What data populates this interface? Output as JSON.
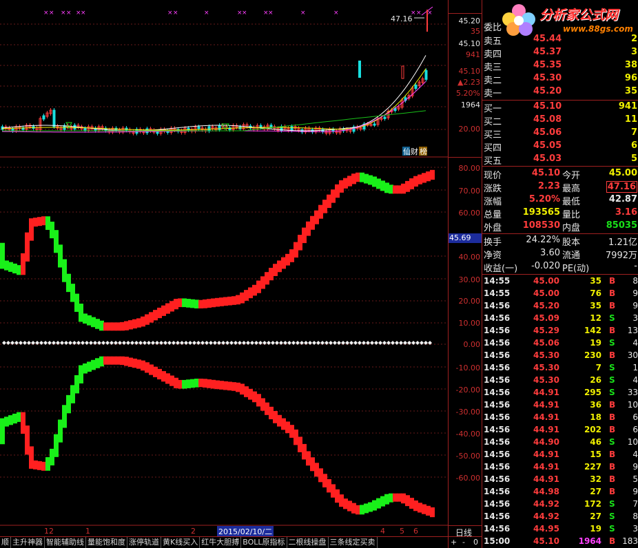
{
  "logo": {
    "site_name": "分析家公式网",
    "url_text": "www.88gs.com"
  },
  "price_chart": {
    "high_label": "47.16",
    "axis": [
      "45.20",
      "35",
      "45.10",
      "941",
      "45.10",
      "▲2.23",
      "5.20%",
      "1964",
      "20.00"
    ],
    "mark_1": "仙",
    "mark_2": "财",
    "mark_3": "榜"
  },
  "osc_axis": [
    "80.00",
    "70.00",
    "60.00",
    "45.69",
    "40.00",
    "30.00",
    "20.00",
    "10.00",
    "0.00",
    "-10.00",
    "-20.00",
    "-30.00",
    "-40.00",
    "-50.00",
    "-60.00"
  ],
  "date_axis": {
    "labels": [
      "12",
      "1",
      "2",
      "2015/02/10/二",
      "4",
      "5",
      "6"
    ]
  },
  "tabs": [
    "顺",
    "主升神器",
    "智能辅助线",
    "量能饱和度",
    "涨停轨道",
    "黄K线买入",
    "红牛大胆搏",
    "BOLL原指标",
    "二根线操盘",
    "三条线定买卖"
  ],
  "period": "日线",
  "nav_buttons": [
    "+",
    "-",
    "0"
  ],
  "orderbook": {
    "ratio_label": "委比",
    "sell": [
      {
        "label": "卖五",
        "price": "45.44",
        "vol": "2"
      },
      {
        "label": "卖四",
        "price": "45.37",
        "vol": "3"
      },
      {
        "label": "卖三",
        "price": "45.35",
        "vol": "38"
      },
      {
        "label": "卖二",
        "price": "45.30",
        "vol": "96"
      },
      {
        "label": "卖一",
        "price": "45.20",
        "vol": "35"
      }
    ],
    "buy": [
      {
        "label": "买一",
        "price": "45.10",
        "vol": "941"
      },
      {
        "label": "买二",
        "price": "45.08",
        "vol": "11"
      },
      {
        "label": "买三",
        "price": "45.06",
        "vol": "7"
      },
      {
        "label": "买四",
        "price": "45.05",
        "vol": "6"
      },
      {
        "label": "买五",
        "price": "45.03",
        "vol": "5"
      }
    ]
  },
  "stats": [
    {
      "l1": "现价",
      "v1": "45.10",
      "l2": "今开",
      "v2": "45.00"
    },
    {
      "l1": "涨跌",
      "v1": "2.23",
      "l2": "最高",
      "v2": "47.16"
    },
    {
      "l1": "涨幅",
      "v1": "5.20%",
      "l2": "最低",
      "v2": "42.87"
    },
    {
      "l1": "总量",
      "v1": "193565",
      "l2": "量比",
      "v2": "3.16"
    },
    {
      "l1": "外盘",
      "v1": "108530",
      "l2": "内盘",
      "v2": "85035"
    }
  ],
  "fund": [
    {
      "l1": "换手",
      "v1": "24.22%",
      "l2": "股本",
      "v2": "1.21亿"
    },
    {
      "l1": "净资",
      "v1": "3.60",
      "l2": "流通",
      "v2": "7992万"
    },
    {
      "l1": "收益(一)",
      "v1": "-0.020",
      "l2": "PE(动)",
      "v2": "-"
    }
  ],
  "ticks": [
    {
      "t": "14:55",
      "p": "45.00",
      "v": "35",
      "bs": "B",
      "n": "8"
    },
    {
      "t": "14:55",
      "p": "45.00",
      "v": "76",
      "bs": "B",
      "n": "9"
    },
    {
      "t": "14:56",
      "p": "45.20",
      "v": "35",
      "bs": "B",
      "n": "9"
    },
    {
      "t": "14:56",
      "p": "45.09",
      "v": "12",
      "bs": "S",
      "n": "3"
    },
    {
      "t": "14:56",
      "p": "45.29",
      "v": "142",
      "bs": "B",
      "n": "13"
    },
    {
      "t": "14:56",
      "p": "45.06",
      "v": "19",
      "bs": "S",
      "n": "4"
    },
    {
      "t": "14:56",
      "p": "45.30",
      "v": "230",
      "bs": "B",
      "n": "30"
    },
    {
      "t": "14:56",
      "p": "45.30",
      "v": "7",
      "bs": "S",
      "n": "1"
    },
    {
      "t": "14:56",
      "p": "45.30",
      "v": "26",
      "bs": "S",
      "n": "4"
    },
    {
      "t": "14:56",
      "p": "44.91",
      "v": "295",
      "bs": "S",
      "n": "33"
    },
    {
      "t": "14:56",
      "p": "44.91",
      "v": "36",
      "bs": "B",
      "n": "10"
    },
    {
      "t": "14:56",
      "p": "44.91",
      "v": "18",
      "bs": "B",
      "n": "6"
    },
    {
      "t": "14:56",
      "p": "44.91",
      "v": "202",
      "bs": "B",
      "n": "6"
    },
    {
      "t": "14:56",
      "p": "44.90",
      "v": "46",
      "bs": "S",
      "n": "10"
    },
    {
      "t": "14:56",
      "p": "44.91",
      "v": "15",
      "bs": "B",
      "n": "4"
    },
    {
      "t": "14:56",
      "p": "44.91",
      "v": "227",
      "bs": "B",
      "n": "9"
    },
    {
      "t": "14:56",
      "p": "44.91",
      "v": "32",
      "bs": "B",
      "n": "5"
    },
    {
      "t": "14:56",
      "p": "44.98",
      "v": "27",
      "bs": "B",
      "n": "9"
    },
    {
      "t": "14:56",
      "p": "44.92",
      "v": "172",
      "bs": "S",
      "n": "7"
    },
    {
      "t": "14:56",
      "p": "44.92",
      "v": "27",
      "bs": "S",
      "n": "8"
    },
    {
      "t": "14:56",
      "p": "44.95",
      "v": "19",
      "bs": "S",
      "n": "3"
    },
    {
      "t": "15:00",
      "p": "45.10",
      "v": "1964",
      "bs": "B",
      "n": "183"
    }
  ],
  "colors": {
    "up": "#ff3c3c",
    "down": "#19e019",
    "axis": "#a02020",
    "bg": "#000000"
  }
}
